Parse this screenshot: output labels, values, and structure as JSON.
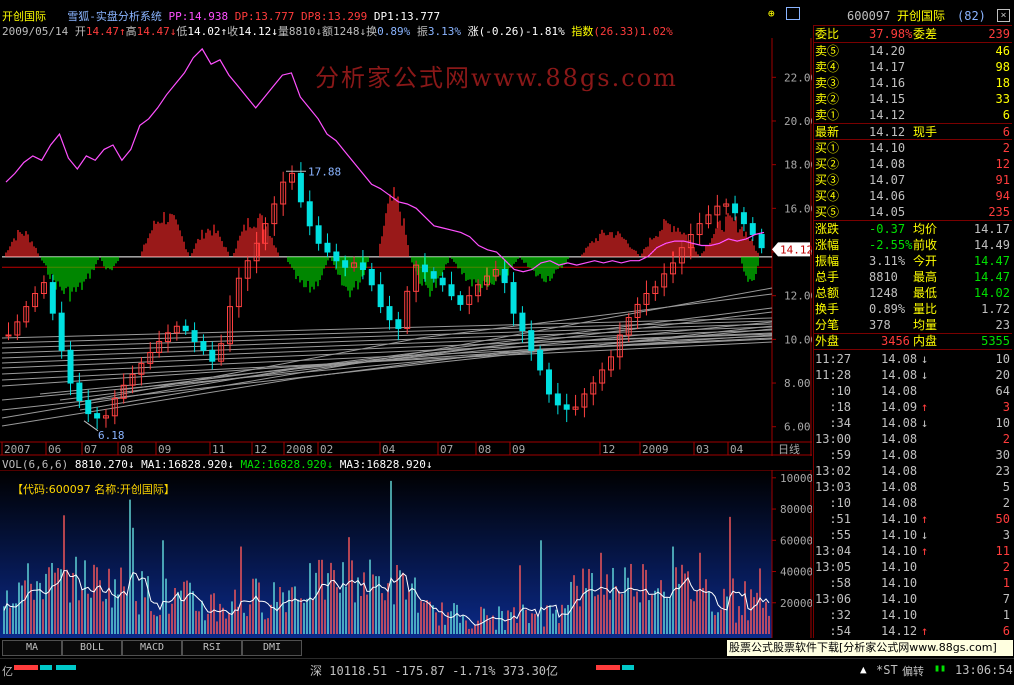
{
  "header": {
    "stock_name": "开创国际",
    "system_name": "雪狐-实盘分析系统",
    "indicators": [
      {
        "label": "PP:",
        "value": "14.938",
        "color": "#ff50ff"
      },
      {
        "label": "DP:",
        "value": "13.777",
        "color": "#ff3c3c"
      },
      {
        "label": "DP8:",
        "value": "13.299",
        "color": "#ff3c3c"
      },
      {
        "label": "DP1:",
        "value": "13.777",
        "color": "#ffffff"
      }
    ],
    "date": "2009/05/14",
    "open_label": "开",
    "open": "14.47",
    "high_label": "高",
    "high": "14.47",
    "low_label": "低",
    "low": "14.02",
    "close_label": "收",
    "close": "14.12",
    "vol_label": "量",
    "vol": "8810",
    "amt_label": "额",
    "amt": "1248",
    "turn_label": "换",
    "turn": "0.89%",
    "amp_label": "振",
    "amp": "3.13%",
    "chg_label": "涨",
    "chg": "(-0.26)-1.81%",
    "idx_label": "指数",
    "idx": "(26.33)1.02%"
  },
  "watermark": "分析家公式网www.88gs.com",
  "chart_data": [
    {
      "type": "line",
      "title": "",
      "y_ticks": [
        "22.00",
        "20.00",
        "18.00",
        "16.00",
        "14.00",
        "12.00",
        "10.00",
        "8.00",
        "6.00"
      ],
      "ylim": [
        5.3,
        23.8
      ],
      "x_ticks": [
        "2007",
        "06",
        "07",
        "08",
        "09",
        "11",
        "12",
        "2008",
        "02",
        "04",
        "07",
        "08",
        "09",
        "12",
        "2009",
        "03",
        "04"
      ],
      "x_axis_label": "日线",
      "annotations": [
        {
          "text": "17.88",
          "value": 17.88
        },
        {
          "text": "6.18",
          "value": 6.18
        }
      ],
      "current_price_tag": "14.12",
      "reference_line_red": 13.3,
      "reference_line_white": 13.78,
      "series": [
        {
          "kind": "close_approx",
          "values": [
            10.2,
            10.8,
            11.5,
            12.1,
            12.6,
            11.2,
            9.5,
            8.0,
            7.2,
            6.6,
            6.4,
            6.5,
            7.3,
            7.9,
            8.4,
            8.9,
            9.4,
            9.9,
            10.3,
            10.6,
            10.4,
            9.9,
            9.5,
            9.0,
            9.8,
            11.5,
            12.8,
            13.6,
            14.4,
            15.3,
            16.2,
            17.2,
            17.6,
            16.3,
            15.2,
            14.4,
            14.0,
            13.6,
            13.3,
            13.5,
            13.2,
            12.5,
            11.5,
            10.9,
            10.5,
            12.2,
            13.4,
            13.1,
            12.8,
            12.5,
            12.0,
            11.6,
            12.0,
            12.5,
            12.9,
            13.2,
            12.6,
            11.2,
            10.4,
            9.5,
            8.6,
            7.5,
            7.0,
            6.8,
            6.9,
            7.5,
            8.0,
            8.6,
            9.2,
            10.2,
            11.0,
            11.6,
            12.1,
            12.4,
            13.0,
            13.5,
            14.2,
            14.8,
            15.3,
            15.7,
            16.1,
            16.2,
            15.8,
            15.3,
            14.8,
            14.2
          ]
        },
        {
          "kind": "magenta_indicator",
          "values": [
            17.2,
            17.6,
            18.1,
            18.4,
            18.2,
            18.9,
            19.4,
            18.3,
            17.8,
            18.4,
            18.2,
            18.7,
            18.9,
            18.2,
            18.7,
            19.8,
            20.1,
            20.6,
            21.2,
            21.7,
            22.2,
            22.9,
            23.3,
            22.6,
            22.8,
            22.1,
            21.6,
            21.1,
            20.6,
            21.1,
            21.6,
            22.1,
            22.2,
            21.1,
            20.6,
            20.1,
            19.4,
            19.1,
            18.6,
            18.1,
            17.6,
            17.1,
            16.9,
            16.6,
            16.3,
            16.2,
            16.0,
            15.6,
            15.2,
            15.1,
            15.0,
            14.9,
            14.7,
            14.3,
            14.1,
            14.0,
            13.6,
            13.2,
            13.1,
            13.2,
            13.5,
            13.6,
            13.4,
            13.5,
            13.4,
            13.5,
            13.6,
            13.5,
            13.6,
            13.5,
            13.6,
            13.6,
            13.8,
            14.2,
            14.4,
            14.5,
            14.5,
            14.4,
            14.3,
            14.3,
            14.4,
            14.6,
            14.5,
            14.6,
            14.8,
            14.9
          ]
        }
      ]
    },
    {
      "type": "bar",
      "title": "VOL(6,6,6)",
      "legend": [
        {
          "label": "",
          "value": "8810.270",
          "arrow": "↓",
          "color": "#ffffff"
        },
        {
          "label": "MA1:",
          "value": "16828.920",
          "arrow": "↓",
          "color": "#ffffff"
        },
        {
          "label": "MA2:",
          "value": "16828.920",
          "arrow": "↓",
          "color": "#00e000"
        },
        {
          "label": "MA3:",
          "value": "16828.920",
          "arrow": "↓",
          "color": "#ffffff"
        }
      ],
      "code_label": "【代码:600097 名称:开创国际】",
      "y_ticks": [
        "100000",
        "80000",
        "60000",
        "40000",
        "20000"
      ],
      "ylim": [
        0,
        105000
      ]
    }
  ],
  "right_panel": {
    "code": "600097",
    "name": "开创国际",
    "count": "(82)",
    "weibi_label": "委比",
    "weibi": "37.98%",
    "weicha_label": "委差",
    "weicha": "239",
    "asks": [
      {
        "label": "卖⑤",
        "price": "14.20",
        "vol": "46"
      },
      {
        "label": "卖④",
        "price": "14.17",
        "vol": "98"
      },
      {
        "label": "卖③",
        "price": "14.16",
        "vol": "18"
      },
      {
        "label": "卖②",
        "price": "14.15",
        "vol": "33"
      },
      {
        "label": "卖①",
        "price": "14.12",
        "vol": "6"
      }
    ],
    "last_label": "最新",
    "last": "14.12",
    "hand_label": "现手",
    "hand": "6",
    "bids": [
      {
        "label": "买①",
        "price": "14.10",
        "vol": "2"
      },
      {
        "label": "买②",
        "price": "14.08",
        "vol": "12"
      },
      {
        "label": "买③",
        "price": "14.07",
        "vol": "91"
      },
      {
        "label": "买④",
        "price": "14.06",
        "vol": "94"
      },
      {
        "label": "买⑤",
        "price": "14.05",
        "vol": "235"
      }
    ],
    "stats": [
      {
        "l1": "涨跌",
        "v1": "-0.37",
        "l2": "均价",
        "v2": "14.17",
        "c1": "#00e000",
        "c2": "#c0c0c0"
      },
      {
        "l1": "涨幅",
        "v1": "-2.55%",
        "l2": "前收",
        "v2": "14.49",
        "c1": "#00e000",
        "c2": "#c0c0c0"
      },
      {
        "l1": "振幅",
        "v1": "3.11%",
        "l2": "今开",
        "v2": "14.47",
        "c1": "#c0c0c0",
        "c2": "#00e000"
      },
      {
        "l1": "总手",
        "v1": "8810",
        "l2": "最高",
        "v2": "14.47",
        "c1": "#c0c0c0",
        "c2": "#00e000"
      },
      {
        "l1": "总额",
        "v1": "1248",
        "l2": "最低",
        "v2": "14.02",
        "c1": "#c0c0c0",
        "c2": "#00e000"
      },
      {
        "l1": "换手",
        "v1": "0.89%",
        "l2": "量比",
        "v2": "1.72",
        "c1": "#c0c0c0",
        "c2": "#c0c0c0"
      },
      {
        "l1": "分笔",
        "v1": "378",
        "l2": "均量",
        "v2": "23",
        "c1": "#c0c0c0",
        "c2": "#c0c0c0"
      }
    ],
    "outer_label": "外盘",
    "outer": "3456",
    "inner_label": "内盘",
    "inner": "5355",
    "ticks": [
      {
        "time": "11:27",
        "price": "14.08",
        "arrow": "↓",
        "vol": "10",
        "vc": "#c0c0c0"
      },
      {
        "time": "11:28",
        "price": "14.08",
        "arrow": "↓",
        "vol": "20",
        "vc": "#c0c0c0"
      },
      {
        "time": ":10",
        "price": "14.08",
        "arrow": "",
        "vol": "64",
        "vc": "#c0c0c0"
      },
      {
        "time": ":18",
        "price": "14.09",
        "arrow": "↑",
        "vol": "3",
        "vc": "#ff3c3c"
      },
      {
        "time": ":34",
        "price": "14.08",
        "arrow": "↓",
        "vol": "10",
        "vc": "#c0c0c0"
      },
      {
        "time": "13:00",
        "price": "14.08",
        "arrow": "",
        "vol": "2",
        "vc": "#ff3c3c"
      },
      {
        "time": ":59",
        "price": "14.08",
        "arrow": "",
        "vol": "30",
        "vc": "#c0c0c0"
      },
      {
        "time": "13:02",
        "price": "14.08",
        "arrow": "",
        "vol": "23",
        "vc": "#c0c0c0"
      },
      {
        "time": "13:03",
        "price": "14.08",
        "arrow": "",
        "vol": "5",
        "vc": "#c0c0c0"
      },
      {
        "time": ":10",
        "price": "14.08",
        "arrow": "",
        "vol": "2",
        "vc": "#c0c0c0"
      },
      {
        "time": ":51",
        "price": "14.10",
        "arrow": "↑",
        "vol": "50",
        "vc": "#ff3c3c"
      },
      {
        "time": ":55",
        "price": "14.10",
        "arrow": "↓",
        "vol": "3",
        "vc": "#c0c0c0"
      },
      {
        "time": "13:04",
        "price": "14.10",
        "arrow": "↑",
        "vol": "11",
        "vc": "#ff3c3c"
      },
      {
        "time": "13:05",
        "price": "14.10",
        "arrow": "",
        "vol": "2",
        "vc": "#ff3c3c"
      },
      {
        "time": ":58",
        "price": "14.10",
        "arrow": "",
        "vol": "1",
        "vc": "#ff3c3c"
      },
      {
        "time": "13:06",
        "price": "14.10",
        "arrow": "",
        "vol": "7",
        "vc": "#c0c0c0"
      },
      {
        "time": ":32",
        "price": "14.10",
        "arrow": "",
        "vol": "1",
        "vc": "#c0c0c0"
      },
      {
        "time": ":54",
        "price": "14.12",
        "arrow": "↑",
        "vol": "6",
        "vc": "#ff3c3c"
      }
    ]
  },
  "tabs": [
    "MA",
    "BOLL",
    "MACD",
    "RSI",
    "DMI"
  ],
  "ad_text": "股票公式股票软件下载[分析家公式网www.88gs.com]",
  "status": {
    "left_label": "亿",
    "index_name": "深",
    "index_value": "10118.51",
    "index_chg": "-175.87",
    "index_pct": "-1.71%",
    "index_amt": "373.30亿",
    "st_label": "*ST",
    "st_sub": "偏转",
    "clock": "13:06:54"
  },
  "colors": {
    "up": "#ff3c3c",
    "down": "#00e000",
    "axis": "#a00000",
    "magenta": "#ff50ff",
    "vol_bg_top": "#000000",
    "vol_bg_bottom": "#0b2a8a"
  }
}
